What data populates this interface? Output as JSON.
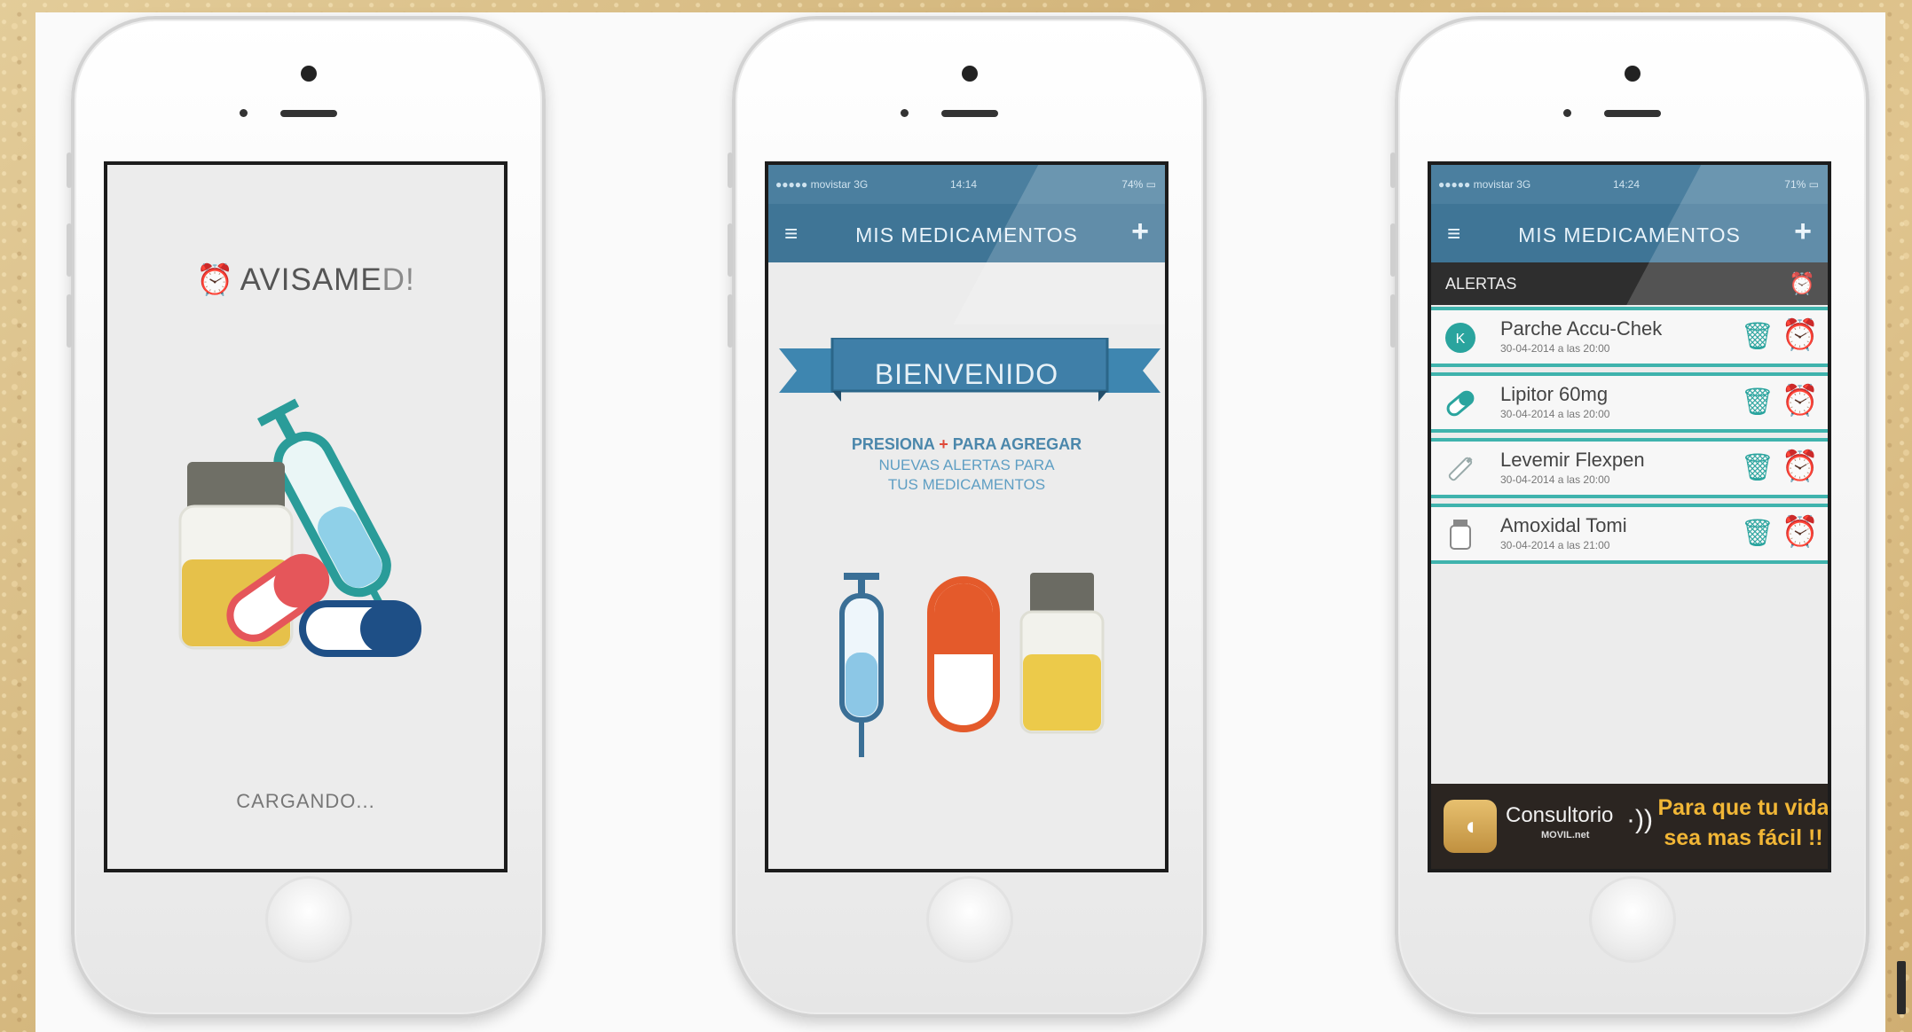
{
  "screen1": {
    "logo_prefix": "AVISAME",
    "logo_suffix": "D!",
    "alarm_icon": "⏰",
    "loading_text": "CARGANDO..."
  },
  "app": {
    "status_carrier": "●●●●● movistar 3G",
    "status_time_2": "14:14",
    "status_battery_2": "74% ▭",
    "status_time_3": "14:24",
    "status_battery_3": "71% ▭",
    "menu_icon": "≡",
    "add_icon": "+",
    "nav_title": "MIS MEDICAMENTOS"
  },
  "screen2": {
    "welcome": "BIENVENIDO",
    "instr_pre": "PRESIONA",
    "instr_plus": "+",
    "instr_post": "PARA AGREGAR",
    "instr_line2": "NUEVAS ALERTAS PARA",
    "instr_line3": "TUS MEDICAMENTOS"
  },
  "screen3": {
    "alerts_label": "ALERTAS",
    "alerts_icon": "⏰",
    "alerts": [
      {
        "name": "Parche Accu-Chek",
        "time": "30-04-2014 a las 20:00",
        "icon": "patch-icon"
      },
      {
        "name": "Lipitor 60mg",
        "time": "30-04-2014 a las 20:00",
        "icon": "pill-icon"
      },
      {
        "name": "Levemir Flexpen",
        "time": "30-04-2014 a las 20:00",
        "icon": "pen-icon"
      },
      {
        "name": "Amoxidal Tomi",
        "time": "30-04-2014 a las 21:00",
        "icon": "bottle-icon"
      }
    ],
    "trash_icon": "🗑",
    "clock_icon": "⏰",
    "banner": {
      "brand": "Consultorio",
      "brand_sub": "MOVIL.net",
      "slogan": "Para que tu vida sea mas fácil !!"
    }
  },
  "colors": {
    "teal": "#3fb3ad",
    "navbar_blue": "#3f7596",
    "accent_red": "#e04a3a",
    "slogan_gold": "#f1b636"
  }
}
